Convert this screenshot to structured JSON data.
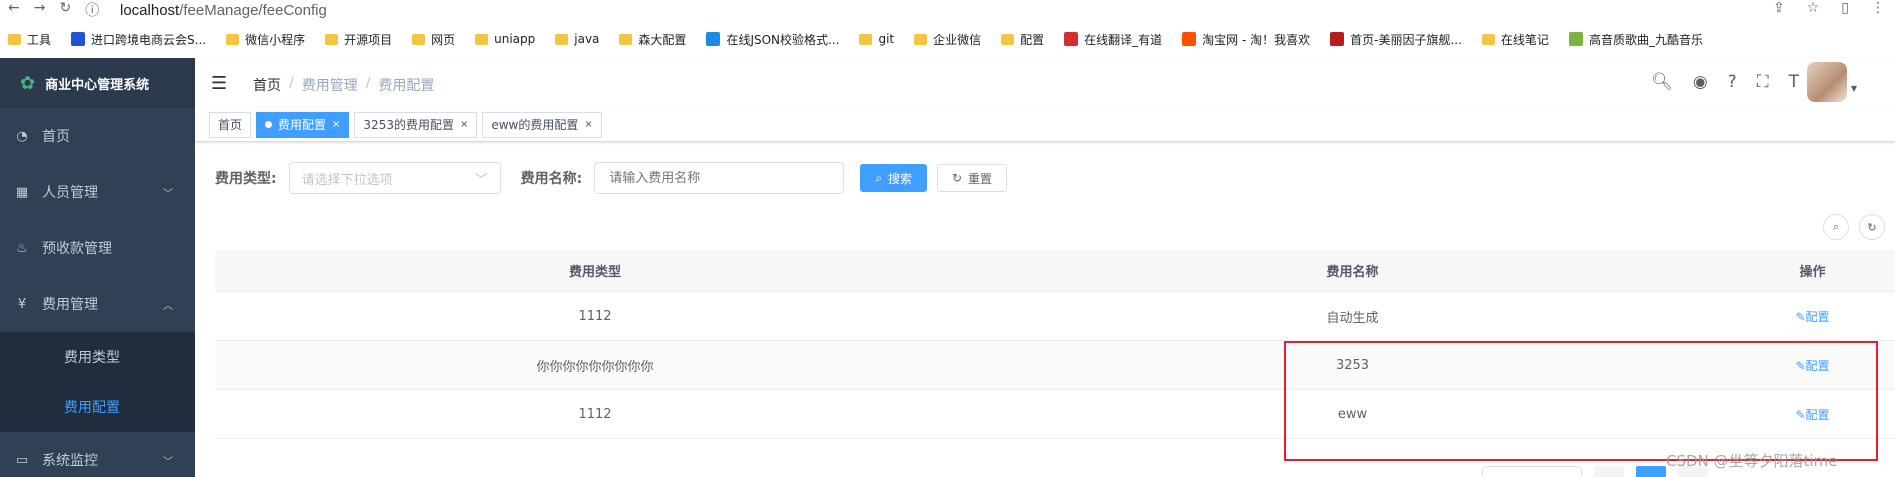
{
  "browser": {
    "url_host": "localhost",
    "url_path": "/feeManage/feeConfig"
  },
  "bookmarks": [
    {
      "label": "工具",
      "kind": "folder"
    },
    {
      "label": "进口跨境电商云会S...",
      "kind": "icon",
      "color": "#2052d6"
    },
    {
      "label": "微信小程序",
      "kind": "folder"
    },
    {
      "label": "开源项目",
      "kind": "folder"
    },
    {
      "label": "网页",
      "kind": "folder"
    },
    {
      "label": "uniapp",
      "kind": "folder"
    },
    {
      "label": "java",
      "kind": "folder"
    },
    {
      "label": "森大配置",
      "kind": "folder"
    },
    {
      "label": "在线JSON校验格式...",
      "kind": "icon",
      "color": "#1e88e5"
    },
    {
      "label": "git",
      "kind": "folder"
    },
    {
      "label": "企业微信",
      "kind": "folder"
    },
    {
      "label": "配置",
      "kind": "folder"
    },
    {
      "label": "在线翻译_有道",
      "kind": "icon",
      "color": "#d32f2f"
    },
    {
      "label": "淘宝网 - 淘！我喜欢",
      "kind": "icon",
      "color": "#ff5000"
    },
    {
      "label": "首页-美丽因子旗舰...",
      "kind": "icon",
      "color": "#b71c1c"
    },
    {
      "label": "在线笔记",
      "kind": "folder"
    },
    {
      "label": "高音质歌曲_九酷音乐",
      "kind": "icon",
      "color": "#7cb342"
    }
  ],
  "sidebar": {
    "title": "商业中心管理系统",
    "items": [
      {
        "label": "首页",
        "icon": "dashboard-icon"
      },
      {
        "label": "人员管理",
        "icon": "shop-icon"
      },
      {
        "label": "预收款管理",
        "icon": "hand-money-icon"
      },
      {
        "label": "费用管理",
        "icon": "yen-icon"
      }
    ],
    "sub_items": [
      {
        "label": "费用类型",
        "active": false
      },
      {
        "label": "费用配置",
        "active": true
      }
    ],
    "last_item": {
      "label": "系统监控",
      "icon": "monitor-icon"
    }
  },
  "header": {
    "breadcrumb": [
      "首页",
      "费用管理",
      "费用配置"
    ]
  },
  "tags": [
    {
      "label": "首页",
      "active": false,
      "closable": false
    },
    {
      "label": "费用配置",
      "active": true,
      "closable": true
    },
    {
      "label": "3253的费用配置",
      "active": false,
      "closable": true
    },
    {
      "label": "eww的费用配置",
      "active": false,
      "closable": true
    }
  ],
  "search": {
    "type_label": "费用类型:",
    "type_placeholder": "请选择下拉选项",
    "name_label": "费用名称:",
    "name_placeholder": "请输入费用名称",
    "search_btn": "搜索",
    "reset_btn": "重置"
  },
  "table": {
    "headers": [
      "费用类型",
      "费用名称",
      "操作"
    ],
    "rows": [
      {
        "type": "1112",
        "name": "自动生成",
        "action": "配置"
      },
      {
        "type": "你你你你你你你你你",
        "name": "3253",
        "action": "配置"
      },
      {
        "type": "1112",
        "name": "eww",
        "action": "配置"
      }
    ]
  },
  "colors": {
    "primary": "#409eff",
    "sidebar_bg": "#304156",
    "highlight": "#e4202c"
  },
  "watermark": "CSDN @坐等夕阳落time"
}
